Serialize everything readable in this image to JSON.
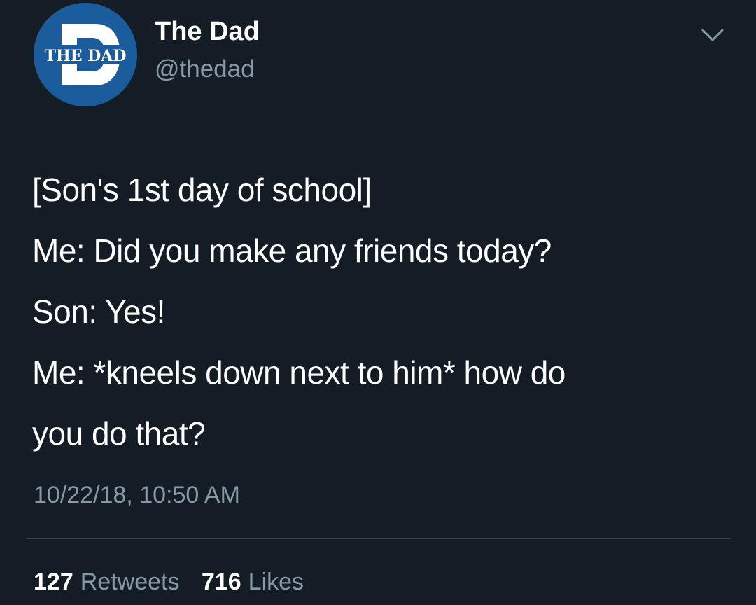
{
  "tweet": {
    "author": {
      "display_name": "The Dad",
      "handle": "@thedad",
      "avatar": {
        "icon": "the-dad-logo",
        "lettering": "THE DAD",
        "colors": {
          "background": "#1b5c9c",
          "letter": "#ffffff",
          "ring": "#ffffff"
        }
      }
    },
    "menu_icon": "chevron-down-icon",
    "lines": [
      "[Son's 1st day of school]",
      "Me: Did you make any friends today?",
      "Son: Yes!",
      "Me: *kneels down next to him* how do",
      "you do that?"
    ],
    "timestamp": "10/22/18, 10:50 AM",
    "stats": {
      "retweets": {
        "count": "127",
        "label": "Retweets"
      },
      "likes": {
        "count": "716",
        "label": "Likes"
      }
    }
  },
  "theme": {
    "background": "#141d26",
    "primary_text": "#ffffff",
    "secondary_text": "#8899a6",
    "divider": "#38444d"
  }
}
